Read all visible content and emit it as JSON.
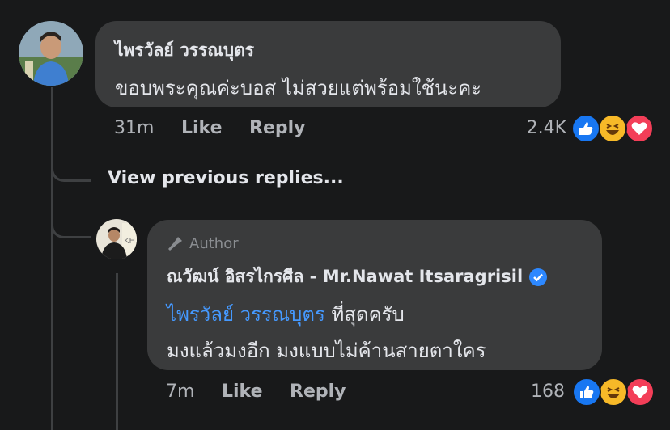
{
  "comment": {
    "author": "ไพรวัลย์ วรรณบุตร",
    "text": "ขอบพระคุณค่ะบอส ไม่สวยแต่พร้อมใช้นะคะ",
    "time": "31m",
    "like_label": "Like",
    "reply_label": "Reply",
    "reaction_count": "2.4K",
    "reactions": [
      "like-icon",
      "haha-icon",
      "love-icon"
    ]
  },
  "view_previous": "View previous replies...",
  "reply": {
    "badge": "Author",
    "author": "ณวัฒน์ อิสรไกรศีล - Mr.Nawat Itsaragrisil",
    "mention": "ไพรวัลย์ วรรณบุตร",
    "text_line1": " ที่สุดครับ",
    "text_line2": "มงแล้วมงอีก มงแบบไม่ค้านสายตาใคร",
    "time": "7m",
    "like_label": "Like",
    "reply_label": "Reply",
    "reaction_count": "168",
    "reactions": [
      "like-icon",
      "haha-icon",
      "love-icon"
    ]
  },
  "colors": {
    "background": "#18191a",
    "bubble": "#3a3b3c",
    "mention": "#4599ff",
    "like": "#1877f2",
    "haha": "#f7b928",
    "love": "#f33e58"
  }
}
